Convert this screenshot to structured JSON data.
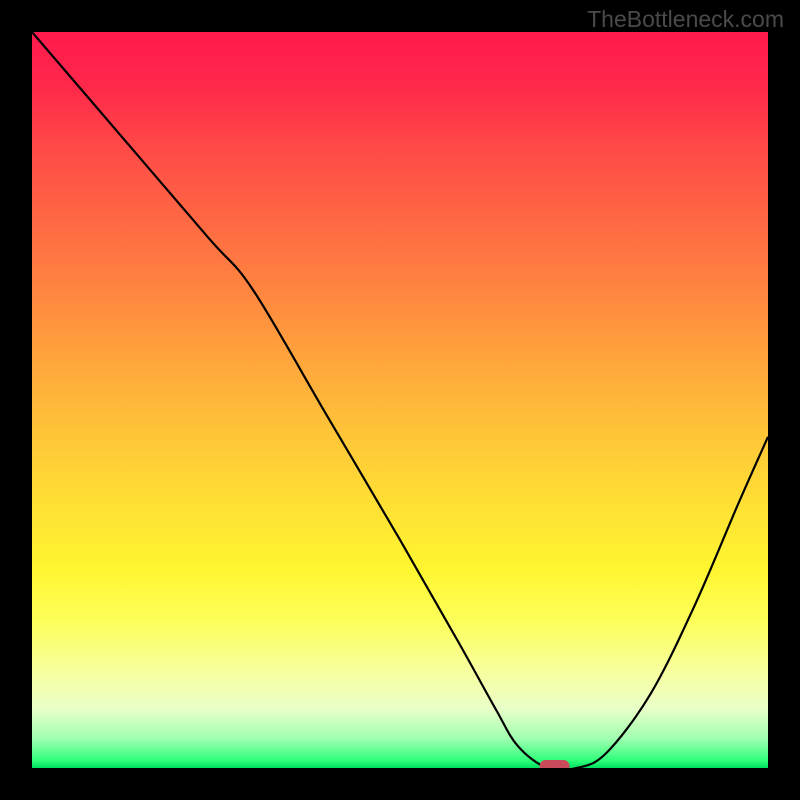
{
  "watermark": "TheBottleneck.com",
  "chart_data": {
    "type": "line",
    "title": "",
    "xlabel": "",
    "ylabel": "",
    "xlim": [
      0,
      100
    ],
    "ylim": [
      0,
      100
    ],
    "x": [
      0,
      12,
      24,
      30,
      40,
      50,
      58,
      63,
      66,
      70,
      74,
      78,
      84,
      90,
      96,
      100
    ],
    "y": [
      100,
      86,
      72,
      65,
      48,
      31,
      17,
      8,
      3,
      0,
      0,
      2,
      10,
      22,
      36,
      45
    ],
    "optimum_marker": {
      "x": 71,
      "y": 0
    },
    "background_gradient": {
      "top_color": "#ff1a4d",
      "mid_color": "#fff630",
      "bottom_color": "#00e060"
    }
  }
}
